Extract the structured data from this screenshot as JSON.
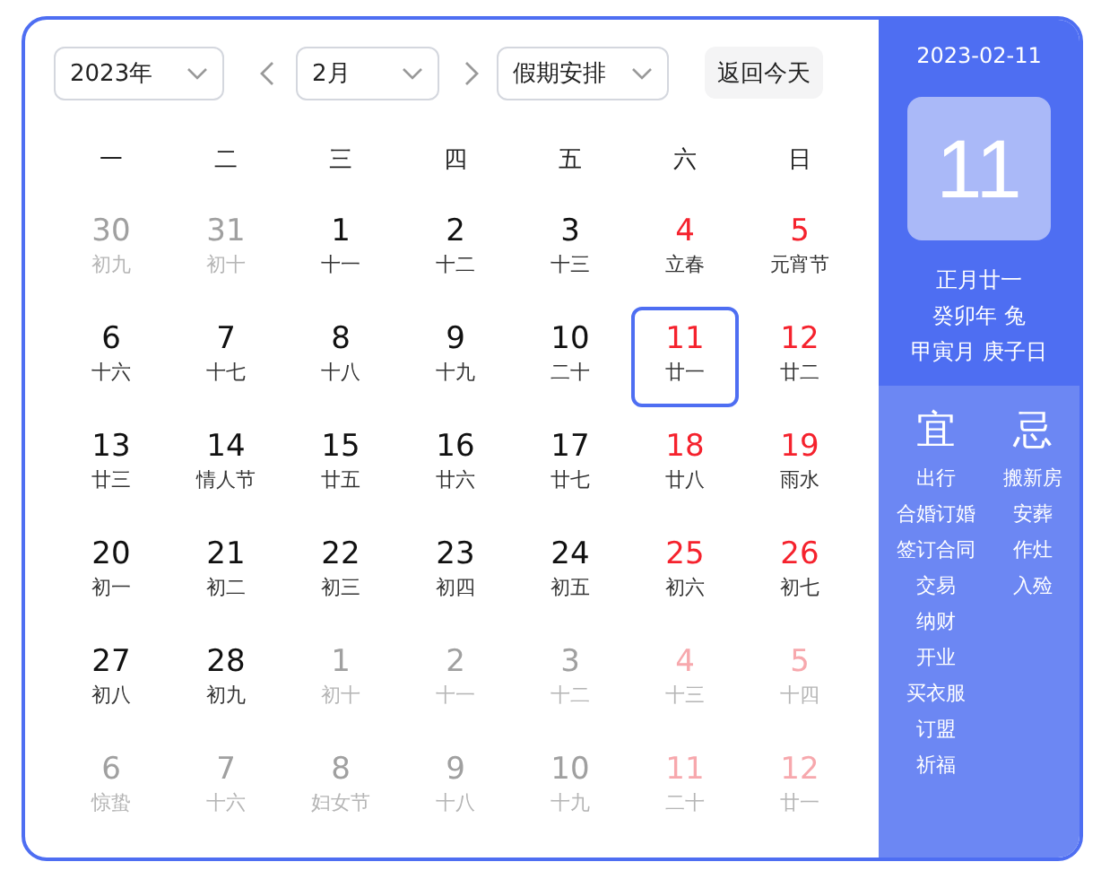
{
  "toolbar": {
    "year": "2023年",
    "month": "2月",
    "holiday": "假期安排",
    "today_button": "返回今天"
  },
  "weekdays": [
    "一",
    "二",
    "三",
    "四",
    "五",
    "六",
    "日"
  ],
  "days": [
    {
      "day": "30",
      "lunar": "初九",
      "other_month": true,
      "weekend": false,
      "selected": false
    },
    {
      "day": "31",
      "lunar": "初十",
      "other_month": true,
      "weekend": false,
      "selected": false
    },
    {
      "day": "1",
      "lunar": "十一",
      "other_month": false,
      "weekend": false,
      "selected": false
    },
    {
      "day": "2",
      "lunar": "十二",
      "other_month": false,
      "weekend": false,
      "selected": false
    },
    {
      "day": "3",
      "lunar": "十三",
      "other_month": false,
      "weekend": false,
      "selected": false
    },
    {
      "day": "4",
      "lunar": "立春",
      "other_month": false,
      "weekend": true,
      "selected": false
    },
    {
      "day": "5",
      "lunar": "元宵节",
      "other_month": false,
      "weekend": true,
      "selected": false
    },
    {
      "day": "6",
      "lunar": "十六",
      "other_month": false,
      "weekend": false,
      "selected": false
    },
    {
      "day": "7",
      "lunar": "十七",
      "other_month": false,
      "weekend": false,
      "selected": false
    },
    {
      "day": "8",
      "lunar": "十八",
      "other_month": false,
      "weekend": false,
      "selected": false
    },
    {
      "day": "9",
      "lunar": "十九",
      "other_month": false,
      "weekend": false,
      "selected": false
    },
    {
      "day": "10",
      "lunar": "二十",
      "other_month": false,
      "weekend": false,
      "selected": false
    },
    {
      "day": "11",
      "lunar": "廿一",
      "other_month": false,
      "weekend": true,
      "selected": true
    },
    {
      "day": "12",
      "lunar": "廿二",
      "other_month": false,
      "weekend": true,
      "selected": false
    },
    {
      "day": "13",
      "lunar": "廿三",
      "other_month": false,
      "weekend": false,
      "selected": false
    },
    {
      "day": "14",
      "lunar": "情人节",
      "other_month": false,
      "weekend": false,
      "selected": false
    },
    {
      "day": "15",
      "lunar": "廿五",
      "other_month": false,
      "weekend": false,
      "selected": false
    },
    {
      "day": "16",
      "lunar": "廿六",
      "other_month": false,
      "weekend": false,
      "selected": false
    },
    {
      "day": "17",
      "lunar": "廿七",
      "other_month": false,
      "weekend": false,
      "selected": false
    },
    {
      "day": "18",
      "lunar": "廿八",
      "other_month": false,
      "weekend": true,
      "selected": false
    },
    {
      "day": "19",
      "lunar": "雨水",
      "other_month": false,
      "weekend": true,
      "selected": false
    },
    {
      "day": "20",
      "lunar": "初一",
      "other_month": false,
      "weekend": false,
      "selected": false
    },
    {
      "day": "21",
      "lunar": "初二",
      "other_month": false,
      "weekend": false,
      "selected": false
    },
    {
      "day": "22",
      "lunar": "初三",
      "other_month": false,
      "weekend": false,
      "selected": false
    },
    {
      "day": "23",
      "lunar": "初四",
      "other_month": false,
      "weekend": false,
      "selected": false
    },
    {
      "day": "24",
      "lunar": "初五",
      "other_month": false,
      "weekend": false,
      "selected": false
    },
    {
      "day": "25",
      "lunar": "初六",
      "other_month": false,
      "weekend": true,
      "selected": false
    },
    {
      "day": "26",
      "lunar": "初七",
      "other_month": false,
      "weekend": true,
      "selected": false
    },
    {
      "day": "27",
      "lunar": "初八",
      "other_month": false,
      "weekend": false,
      "selected": false
    },
    {
      "day": "28",
      "lunar": "初九",
      "other_month": false,
      "weekend": false,
      "selected": false
    },
    {
      "day": "1",
      "lunar": "初十",
      "other_month": true,
      "weekend": false,
      "selected": false
    },
    {
      "day": "2",
      "lunar": "十一",
      "other_month": true,
      "weekend": false,
      "selected": false
    },
    {
      "day": "3",
      "lunar": "十二",
      "other_month": true,
      "weekend": false,
      "selected": false
    },
    {
      "day": "4",
      "lunar": "十三",
      "other_month": true,
      "weekend": true,
      "selected": false
    },
    {
      "day": "5",
      "lunar": "十四",
      "other_month": true,
      "weekend": true,
      "selected": false
    },
    {
      "day": "6",
      "lunar": "惊蛰",
      "other_month": true,
      "weekend": false,
      "selected": false
    },
    {
      "day": "7",
      "lunar": "十六",
      "other_month": true,
      "weekend": false,
      "selected": false
    },
    {
      "day": "8",
      "lunar": "妇女节",
      "other_month": true,
      "weekend": false,
      "selected": false
    },
    {
      "day": "9",
      "lunar": "十八",
      "other_month": true,
      "weekend": false,
      "selected": false
    },
    {
      "day": "10",
      "lunar": "十九",
      "other_month": true,
      "weekend": false,
      "selected": false
    },
    {
      "day": "11",
      "lunar": "二十",
      "other_month": true,
      "weekend": true,
      "selected": false
    },
    {
      "day": "12",
      "lunar": "廿一",
      "other_month": true,
      "weekend": true,
      "selected": false
    }
  ],
  "detail": {
    "date": "2023-02-11",
    "day": "11",
    "lunar_lines": [
      "正月廿一",
      "癸卯年 兔",
      "甲寅月 庚子日"
    ],
    "good": {
      "title": "宜",
      "items": [
        "出行",
        "合婚订婚",
        "签订合同",
        "交易",
        "纳财",
        "开业",
        "买衣服",
        "订盟",
        "祈福"
      ]
    },
    "bad": {
      "title": "忌",
      "items": [
        "搬新房",
        "安葬",
        "作灶",
        "入殓"
      ]
    }
  }
}
